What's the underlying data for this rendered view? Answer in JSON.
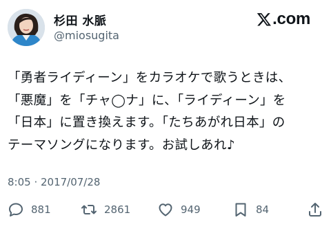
{
  "author": {
    "name": "杉田 水脈",
    "handle": "@miosugita"
  },
  "brand": {
    "logo_text": ".com"
  },
  "tweet": {
    "text": "「勇者ライディーン」をカラオケで歌うときは、\n「悪魔」を「チャ◯ナ」に、「ライディーン」を\n「日本」に置き換えます。「たちあがれ日本」の\nテーマソングになります。お試しあれ♪"
  },
  "meta": {
    "timestamp": "8:05 · 2017/07/28"
  },
  "actions": {
    "reply_count": "881",
    "retweet_count": "2861",
    "like_count": "949",
    "bookmark_count": "84"
  },
  "icons": [
    "avatar",
    "x-logo-icon",
    "reply-icon",
    "retweet-icon",
    "heart-icon",
    "bookmark-icon",
    "share-icon"
  ]
}
